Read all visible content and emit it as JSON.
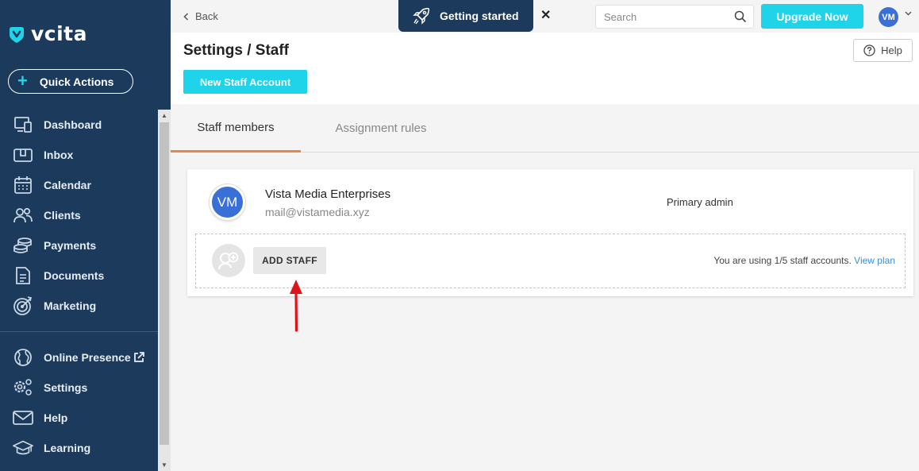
{
  "sidebar": {
    "logo_text": "vcita",
    "quick_actions_label": "Quick Actions",
    "items": [
      {
        "label": "Dashboard",
        "icon": "dashboard-icon"
      },
      {
        "label": "Inbox",
        "icon": "inbox-icon"
      },
      {
        "label": "Calendar",
        "icon": "calendar-icon"
      },
      {
        "label": "Clients",
        "icon": "clients-icon"
      },
      {
        "label": "Payments",
        "icon": "payments-icon"
      },
      {
        "label": "Documents",
        "icon": "documents-icon"
      },
      {
        "label": "Marketing",
        "icon": "marketing-icon"
      }
    ],
    "bottom_items": [
      {
        "label": "Online Presence",
        "icon": "globe-icon"
      },
      {
        "label": "Settings",
        "icon": "settings-icon"
      },
      {
        "label": "Help",
        "icon": "mail-icon"
      },
      {
        "label": "Learning",
        "icon": "graduation-cap-icon"
      }
    ]
  },
  "topbar": {
    "back_label": "Back",
    "getting_started_label": "Getting started",
    "search_placeholder": "Search",
    "upgrade_label": "Upgrade Now",
    "avatar_initials": "VM"
  },
  "header": {
    "title": "Settings / Staff",
    "new_staff_label": "New Staff Account",
    "help_label": "Help"
  },
  "tabs": [
    {
      "label": "Staff members",
      "active": true
    },
    {
      "label": "Assignment rules",
      "active": false
    }
  ],
  "staff": [
    {
      "initials": "VM",
      "name": "Vista Media Enterprises",
      "email": "mail@vistamedia.xyz",
      "role": "Primary admin"
    }
  ],
  "add_staff": {
    "button_label": "ADD STAFF",
    "usage_text": "You are using 1/5 staff accounts.",
    "view_plan_label": "View plan"
  },
  "colors": {
    "sidebar_bg": "#1b3a5c",
    "accent": "#1fd3e8",
    "tab_underline": "#e8864a",
    "avatar": "#3a6fd8",
    "annotation_arrow": "#e0131a"
  }
}
